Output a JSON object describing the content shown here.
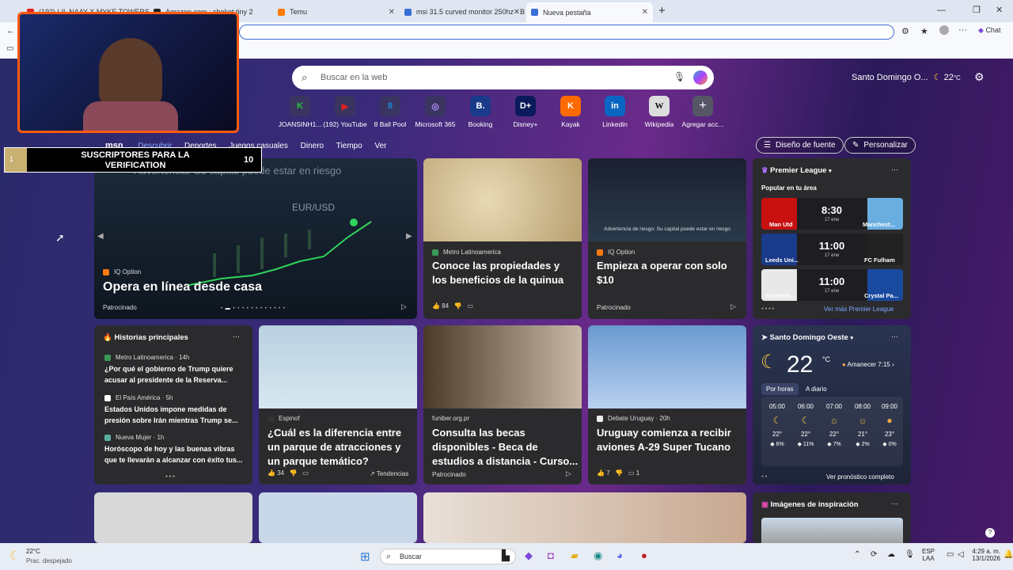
{
  "browser": {
    "tabs": [
      {
        "label": "(192) LIL NAAY X MYKE TOWERS",
        "color": "#e02020"
      },
      {
        "label": "Amazon.com : chekot tiny 2",
        "color": "#222"
      },
      {
        "label": "Temu",
        "color": "#ff7a00"
      },
      {
        "label": "msi 31.5 curved monitor 250hz - B",
        "color": "#3b6ed8"
      },
      {
        "label": "Nueva pestaña",
        "color": "#3b6ed8"
      }
    ],
    "chat_label": "Chat"
  },
  "search": {
    "placeholder": "Buscar en la web"
  },
  "quick_links": [
    {
      "label": "JOANSINH1...",
      "glyph": "K",
      "color": "#29c23a"
    },
    {
      "label": "(192) YouTube",
      "glyph": "▶",
      "color": "#e02020"
    },
    {
      "label": "8 Ball Pool",
      "glyph": "8",
      "color": "#1a8ad8"
    },
    {
      "label": "Microsoft 365",
      "glyph": "◎",
      "color": "#7a4ad8"
    },
    {
      "label": "Booking",
      "glyph": "B.",
      "color": "#1a3a8a"
    },
    {
      "label": "Disney+",
      "glyph": "D+",
      "color": "#0a1a5a"
    },
    {
      "label": "Kayak",
      "glyph": "K",
      "color": "#ff6a00"
    },
    {
      "label": "Linkedin",
      "glyph": "in",
      "color": "#0a66c2"
    },
    {
      "label": "Wikipedia",
      "glyph": "W",
      "color": "#cccccc"
    },
    {
      "label": "Agregar acc...",
      "glyph": "+",
      "color": "#555566"
    }
  ],
  "weather_top": {
    "location": "Santo Domingo O...",
    "temp": "22",
    "unit": "°C"
  },
  "nav": {
    "logo": "msn",
    "items": [
      "Descubrir",
      "Deportes",
      "Juegos casuales",
      "Dinero",
      "Tiempo",
      "Ver"
    ],
    "font_button": "Diseño de fuente",
    "personalize_button": "Personalizar"
  },
  "hero": {
    "warning": "Advertencia: Su capital puede estar en riesgo",
    "pair": "EUR/USD",
    "source": "IQ Option",
    "title": "Opera en línea desde casa",
    "sponsored": "Patrocinado"
  },
  "card_quinoa": {
    "source": "Metro Latinoamerica",
    "title": "Conoce las propiedades y los beneficios de la quinua",
    "likes": "84"
  },
  "card_trade": {
    "caption": "Advertencia de riesgo: Su capital puede estar en riesgo",
    "source": "IQ Option",
    "title": "Empieza a operar con solo $10",
    "sponsored": "Patrocinado"
  },
  "league": {
    "title": "Premier League",
    "subtitle": "Popular en tu área",
    "matches": [
      {
        "home": "Man Utd",
        "time": "8:30",
        "date": "17 ene",
        "away": "Manchest..."
      },
      {
        "home": "Leeds Uni...",
        "time": "11:00",
        "date": "17 ene",
        "away": "FC Fulham"
      },
      {
        "home": "Sunderla...",
        "time": "11:00",
        "date": "17 ene",
        "away": "Crystal Pa..."
      }
    ],
    "more": "Ver más Premier League"
  },
  "top_stories": {
    "title": "Historias principales",
    "items": [
      {
        "source": "Metro Latinoamerica · 14h",
        "text": "¿Por qué el gobierno de Trump quiere acusar al presidente de la Reserva..."
      },
      {
        "source": "El País América · 5h",
        "text": "Estados Unidos impone medidas de presión sobre Irán mientras Trump se..."
      },
      {
        "source": "Nueva Mujer · 1h",
        "text": "Horóscopo de hoy y las buenas vibras que te llevarán a alcanzar con éxito tus..."
      }
    ]
  },
  "card_park": {
    "source": "Espinof",
    "title": "¿Cuál es la diferencia entre un parque de atracciones y un parque temático?",
    "likes": "34",
    "trend": "Tendencias"
  },
  "card_study": {
    "source": "funiber.org.pr",
    "title": "Consulta las becas disponibles - Beca de estudios a distancia - Curso...",
    "sponsored": "Patrocinado"
  },
  "card_plane": {
    "source": "Debate Uruguay · 20h",
    "title": "Uruguay comienza a recibir aviones A-29 Super Tucano",
    "likes": "7",
    "comments": "1"
  },
  "weather": {
    "location": "Santo Domingo Oeste",
    "temp": "22",
    "unit": "°C",
    "sunrise": "Amanecer 7:15",
    "tab_hourly": "Por horas",
    "tab_daily": "A diario",
    "hours": [
      {
        "time": "05:00",
        "temp": "22°",
        "rain": "6%"
      },
      {
        "time": "06:00",
        "temp": "22°",
        "rain": "11%"
      },
      {
        "time": "07:00",
        "temp": "22°",
        "rain": "7%"
      },
      {
        "time": "08:00",
        "temp": "21°",
        "rain": "2%"
      },
      {
        "time": "09:00",
        "temp": "23°",
        "rain": "0%"
      }
    ],
    "full_forecast": "Ver pronóstico completo"
  },
  "inspiration": {
    "title": "Imágenes de inspiración"
  },
  "overlay": {
    "sub_rank": "1",
    "sub_text": "SUSCRIPTORES PARA LA VERIFICATION",
    "sub_count": "10"
  },
  "taskbar": {
    "weather_temp": "22°C",
    "weather_desc": "Prac. despejado",
    "search": "Buscar",
    "lang1": "ESP",
    "lang2": "LAA",
    "time": "4:29 a. m.",
    "date": "13/1/2026"
  }
}
